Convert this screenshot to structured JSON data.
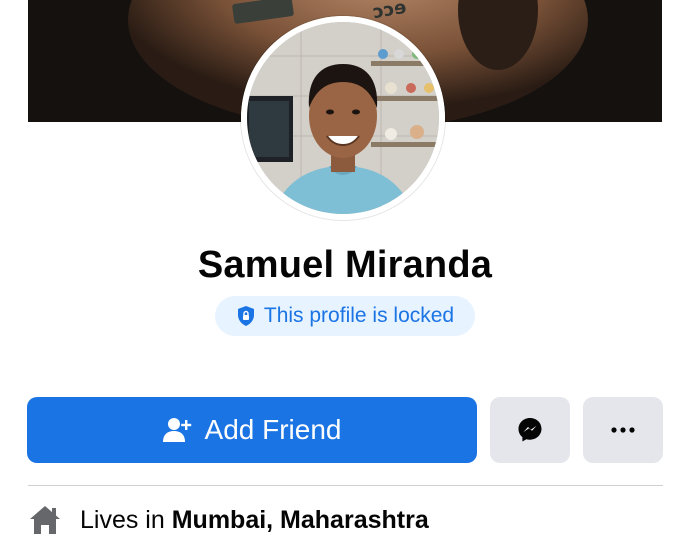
{
  "profile": {
    "name": "Samuel Miranda",
    "locked_text": "This profile is locked"
  },
  "actions": {
    "add_friend_label": "Add Friend",
    "messenger_icon": "messenger-icon",
    "more_icon": "more-options-icon"
  },
  "intro": {
    "lives_prefix": "Lives in",
    "lives_location": "Mumbai, Maharashtra",
    "icon": "home-icon"
  },
  "colors": {
    "accent": "#1b74e4",
    "badge_bg": "#e7f3ff",
    "button_gray": "#e4e6eb"
  }
}
